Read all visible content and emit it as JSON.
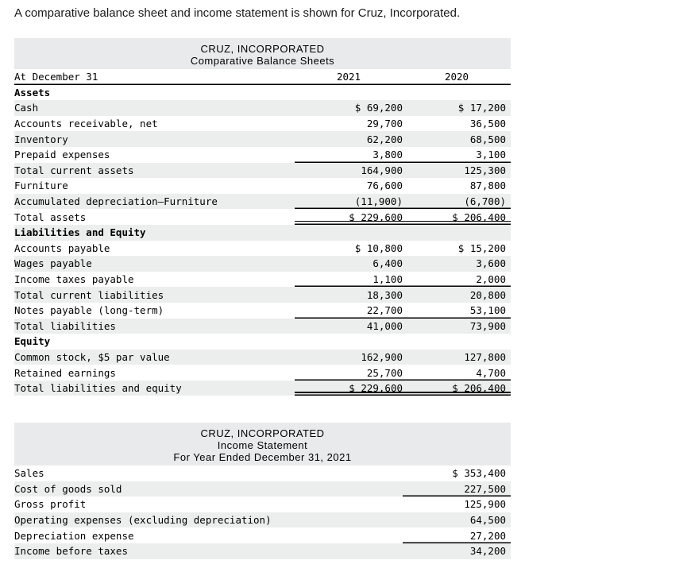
{
  "intro": "A comparative balance sheet and income statement is shown for Cruz, Incorporated.",
  "balance_sheet": {
    "company": "CRUZ, INCORPORATED",
    "statement": "Comparative Balance Sheets",
    "header": {
      "label": "At December 31",
      "col1": "2021",
      "col2": "2020"
    },
    "rows": [
      {
        "label": "Assets",
        "v1": "",
        "v2": "",
        "bold": true,
        "shade": false
      },
      {
        "label": "Cash",
        "v1": "$ 69,200",
        "v2": "$ 17,200",
        "bold": false,
        "shade": true
      },
      {
        "label": "Accounts receivable, net",
        "v1": "29,700",
        "v2": "36,500",
        "bold": false,
        "shade": false
      },
      {
        "label": "Inventory",
        "v1": "62,200",
        "v2": "68,500",
        "bold": false,
        "shade": true
      },
      {
        "label": "Prepaid expenses",
        "v1": "3,800",
        "v2": "3,100",
        "bold": false,
        "shade": false,
        "rule1": "single",
        "rule2": "single"
      },
      {
        "label": "Total current assets",
        "v1": "164,900",
        "v2": "125,300",
        "bold": false,
        "shade": true
      },
      {
        "label": "Furniture",
        "v1": "76,600",
        "v2": "87,800",
        "bold": false,
        "shade": false
      },
      {
        "label": "Accumulated depreciation—Furniture",
        "v1": "(11,900)",
        "v2": "(6,700)",
        "bold": false,
        "shade": true,
        "rule1": "single",
        "rule2": "single"
      },
      {
        "label": "Total assets",
        "v1": "$ 229,600",
        "v2": "$ 206,400",
        "bold": false,
        "shade": false,
        "rule1": "double",
        "rule2": "double"
      },
      {
        "label": "Liabilities and Equity",
        "v1": "",
        "v2": "",
        "bold": true,
        "shade": true
      },
      {
        "label": "Accounts payable",
        "v1": "$ 10,800",
        "v2": "$ 15,200",
        "bold": false,
        "shade": false
      },
      {
        "label": "Wages payable",
        "v1": "6,400",
        "v2": "3,600",
        "bold": false,
        "shade": true
      },
      {
        "label": "Income taxes payable",
        "v1": "1,100",
        "v2": "2,000",
        "bold": false,
        "shade": false,
        "rule1": "single",
        "rule2": "single"
      },
      {
        "label": "Total current liabilities",
        "v1": "18,300",
        "v2": "20,800",
        "bold": false,
        "shade": true
      },
      {
        "label": "Notes payable (long-term)",
        "v1": "22,700",
        "v2": "53,100",
        "bold": false,
        "shade": false,
        "rule1": "single",
        "rule2": "single"
      },
      {
        "label": "Total liabilities",
        "v1": "41,000",
        "v2": "73,900",
        "bold": false,
        "shade": true
      },
      {
        "label": "Equity",
        "v1": "",
        "v2": "",
        "bold": true,
        "shade": false
      },
      {
        "label": "Common stock, $5 par value",
        "v1": "162,900",
        "v2": "127,800",
        "bold": false,
        "shade": true
      },
      {
        "label": "Retained earnings",
        "v1": "25,700",
        "v2": "4,700",
        "bold": false,
        "shade": false,
        "rule1": "single",
        "rule2": "single"
      },
      {
        "label": "Total liabilities and equity",
        "v1": "$ 229,600",
        "v2": "$ 206,400",
        "bold": false,
        "shade": true,
        "rule1": "double",
        "rule2": "double"
      }
    ]
  },
  "income_statement": {
    "company": "CRUZ, INCORPORATED",
    "statement": "Income Statement",
    "period": "For Year Ended December 31, 2021",
    "rows": [
      {
        "label": "Sales",
        "v2": "$ 353,400",
        "shade": false
      },
      {
        "label": "Cost of goods sold",
        "v2": "227,500",
        "shade": true,
        "rule2": "single"
      },
      {
        "label": "Gross profit",
        "v2": "125,900",
        "shade": false
      },
      {
        "label": "Operating expenses (excluding depreciation)",
        "v2": "64,500",
        "shade": true
      },
      {
        "label": "Depreciation expense",
        "v2": "27,200",
        "shade": false,
        "rule2": "single"
      },
      {
        "label": "Income before taxes",
        "v2": "34,200",
        "shade": true
      }
    ]
  }
}
